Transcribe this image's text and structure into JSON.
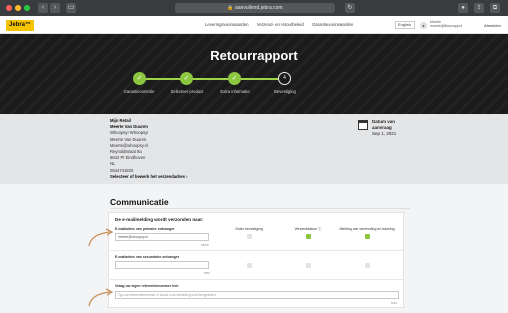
{
  "browser": {
    "url": "🔒 aanvullend.jebra.com",
    "traffic_colors": [
      "#fe5f57",
      "#febc2e",
      "#28c840"
    ]
  },
  "header": {
    "logo": "Jebra™",
    "nav": [
      "Leveringsvoorwaarden",
      "Verzend- en retourbeleid",
      "Garantievoorwaarden"
    ],
    "language": "English",
    "account_line1": "Moerie",
    "account_line2": "moerie@illusoopy.nl",
    "logout": "Afmelden"
  },
  "hero": {
    "title": "Retourrapport",
    "steps": [
      {
        "label": "Garantiecontrole",
        "done": true
      },
      {
        "label": "Selecteer product",
        "done": true
      },
      {
        "label": "Extra informatie",
        "done": true
      },
      {
        "label": "Bevestiging",
        "done": false,
        "number": "4"
      }
    ]
  },
  "address": {
    "heading": "Mijn Retail",
    "name": "Meerte Van Duuren",
    "lines": [
      "Whoopsy! Whoopsy!",
      "Meerte Van Duuren",
      "Meerte@whoopsy.nl",
      "Reynoldstraat 9a",
      "5642 PI Eindhoven",
      "NL",
      "0642741820"
    ],
    "select_link": "Selecteer of bewerk het verzendadres ›",
    "date_label1": "Datum van",
    "date_label2": "aanvraag",
    "date_value": "Sep 1, 2021"
  },
  "communicatie": {
    "title": "Communicatie",
    "card_heading": "De e-mailmelding wordt verzonden naar:",
    "columns": [
      "Order bevestiging",
      "Verzenddatum ⓘ",
      "Melding van verzending en tracking"
    ],
    "rows": [
      {
        "label": "E-mailadres van primaire ontvanger",
        "value": "meerte@whoopsy.nl",
        "counter": "18/50",
        "checks": [
          false,
          true,
          true
        ]
      },
      {
        "label": "E-mailadres van secundaire ontvanger",
        "value": "",
        "counter": "0/50",
        "checks": [
          false,
          false,
          false
        ]
      }
    ],
    "ref_label": "Vraag uw eigen referentienummer hier",
    "ref_placeholder": "Typ uw referentienummer in zodat u uw bestelling kunt terugvinden",
    "ref_counter": "0/30"
  },
  "colors": {
    "accent": "#8cc63f",
    "brand": "#f5c400",
    "arrow": "#c8915a"
  }
}
